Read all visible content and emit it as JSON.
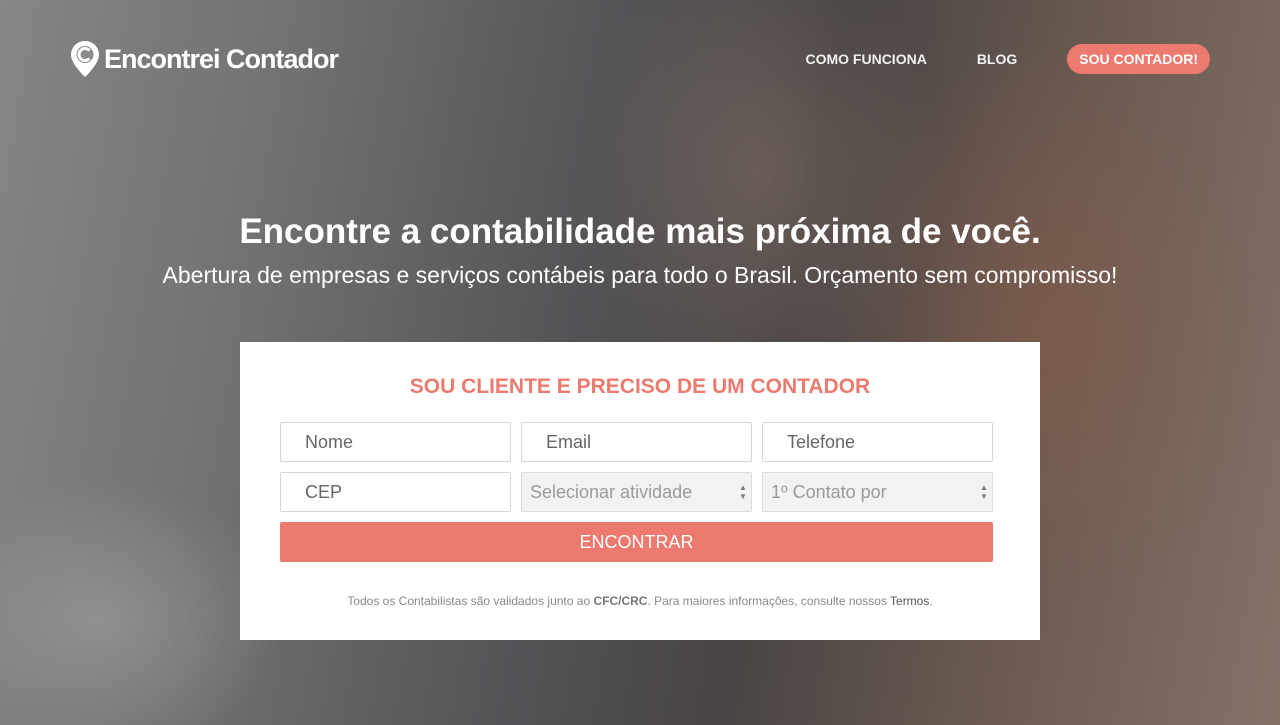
{
  "header": {
    "logo_text": "Encontrei Contador",
    "nav": {
      "how_it_works": "COMO FUNCIONA",
      "blog": "BLOG",
      "cta": "SOU CONTADOR!"
    }
  },
  "hero": {
    "headline": "Encontre a contabilidade mais próxima de você.",
    "subheadline": "Abertura de empresas e serviços contábeis para todo o Brasil. Orçamento sem compromisso!"
  },
  "form": {
    "title": "SOU CLIENTE E PRECISO DE UM CONTADOR",
    "name_placeholder": "Nome",
    "email_placeholder": "Email",
    "phone_placeholder": "Telefone",
    "cep_placeholder": "CEP",
    "activity_select": "Selecionar atividade",
    "contact_select": "1º Contato por",
    "submit_label": "ENCONTRAR",
    "disclaimer_prefix": "Todos os Contabilistas são validados junto ao ",
    "disclaimer_bold": "CFC/CRC",
    "disclaimer_middle": ". Para maiores informações, consulte nossos ",
    "disclaimer_link": "Termos",
    "disclaimer_suffix": "."
  },
  "colors": {
    "accent": "#ec7a6f",
    "card_bg": "#ffffff"
  }
}
